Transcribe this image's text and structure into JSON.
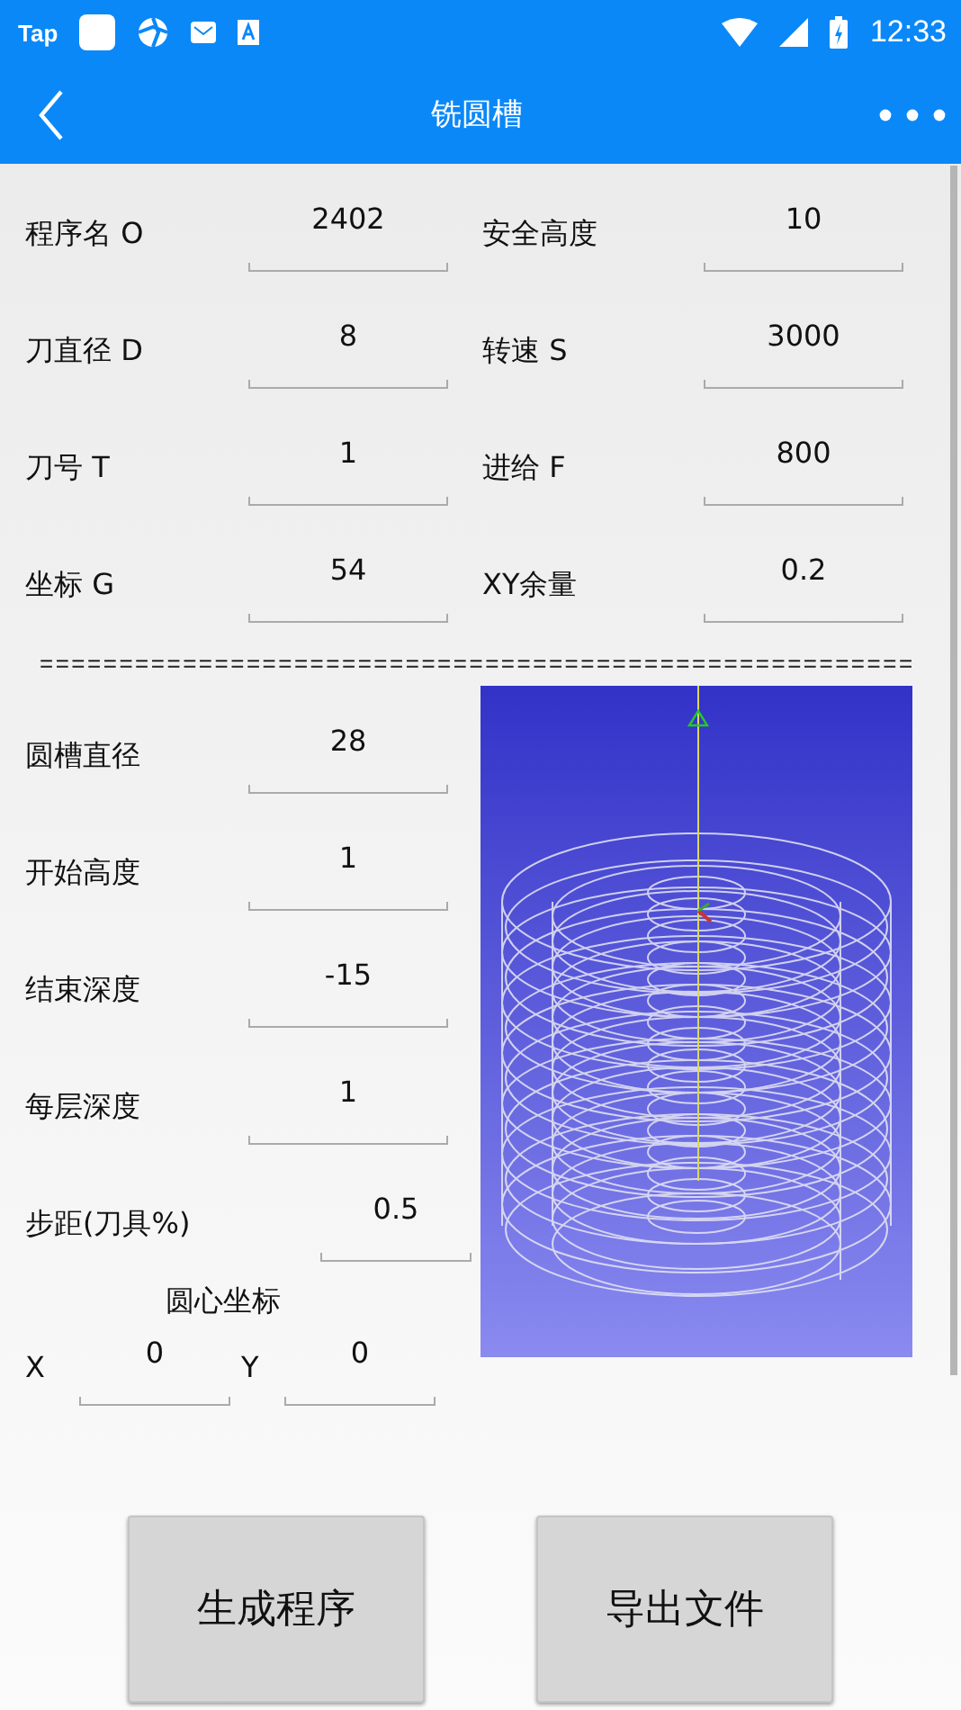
{
  "status_bar": {
    "app_label": "Tap",
    "time": "12:33"
  },
  "app_bar": {
    "title": "铣圆槽"
  },
  "top_fields": [
    {
      "label": "程序名 O",
      "value": "2402"
    },
    {
      "label": "安全高度",
      "value": "10"
    },
    {
      "label": "刀直径 D",
      "value": "8"
    },
    {
      "label": "转速 S",
      "value": "3000"
    },
    {
      "label": "刀号 T",
      "value": "1"
    },
    {
      "label": "进给 F",
      "value": "800"
    },
    {
      "label": "坐标 G",
      "value": "54"
    },
    {
      "label": "XY余量",
      "value": "0.2"
    }
  ],
  "separator": "=======================================================",
  "slot_fields": [
    {
      "label": "圆槽直径",
      "value": "28"
    },
    {
      "label": "开始高度",
      "value": "1"
    },
    {
      "label": "结束深度",
      "value": "-15"
    },
    {
      "label": "每层深度",
      "value": "1"
    }
  ],
  "step_field": {
    "label": "步距(刀具%)",
    "value": "0.5"
  },
  "center": {
    "title": "圆心坐标",
    "x_label": "X",
    "x_value": "0",
    "y_label": "Y",
    "y_value": "0"
  },
  "buttons": [
    "生成程序",
    "导出文件"
  ]
}
